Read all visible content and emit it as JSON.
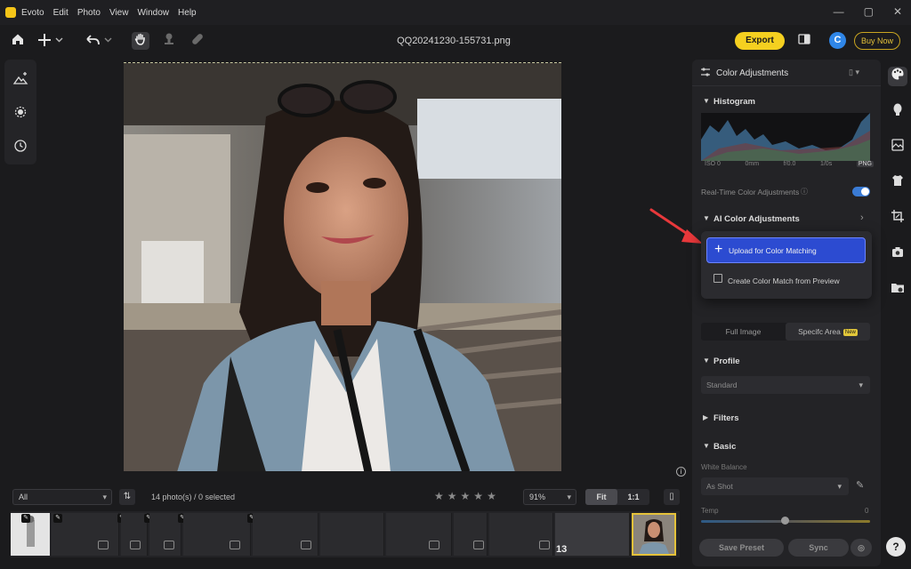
{
  "app": {
    "name": "Evoto"
  },
  "menu": [
    "Evoto",
    "Edit",
    "Photo",
    "View",
    "Window",
    "Help"
  ],
  "window_controls": [
    "—",
    "▢",
    "✕"
  ],
  "toolbar": {
    "file_name": "QQ20241230-155731.png",
    "export_label": "Export",
    "avatar_letter": "C",
    "buy_label": "Buy Now"
  },
  "filmstrip": {
    "filter_value": "All",
    "photo_count": "14 photo(s) / 0 selected",
    "zoom_value": "91%",
    "fit_label": "Fit",
    "one_to_one_label": "1:1",
    "thumb_number": "13",
    "rating_stars": 5
  },
  "panel": {
    "title": "Color Adjustments",
    "histogram_title": "Histogram",
    "histogram_labels": [
      "ISO 0",
      "0mm",
      "f/0.0",
      "1/0s",
      "PNG"
    ],
    "realtime_label": "Real-Time Color Adjustments",
    "realtime_on": true,
    "ai_title": "AI Color Adjustments",
    "seg_full": "Full Image",
    "seg_specific": "Specifc Area",
    "new_badge": "New",
    "profile_title": "Profile",
    "profile_value": "Standard",
    "filters_title": "Filters",
    "basic_title": "Basic",
    "white_balance_label": "White Balance",
    "white_balance_value": "As Shot",
    "temp_label": "Temp",
    "temp_value": "0",
    "save_preset_label": "Save Preset",
    "sync_label": "Sync"
  },
  "popup": {
    "primary_label": "Upload for Color Matching",
    "secondary_label": "Create Color Match from Preview"
  },
  "colors": {
    "accent_yellow": "#f5d020",
    "accent_blue": "#2c4bd1",
    "arrow_red": "#e8383b",
    "background": "#1b1b1d"
  }
}
